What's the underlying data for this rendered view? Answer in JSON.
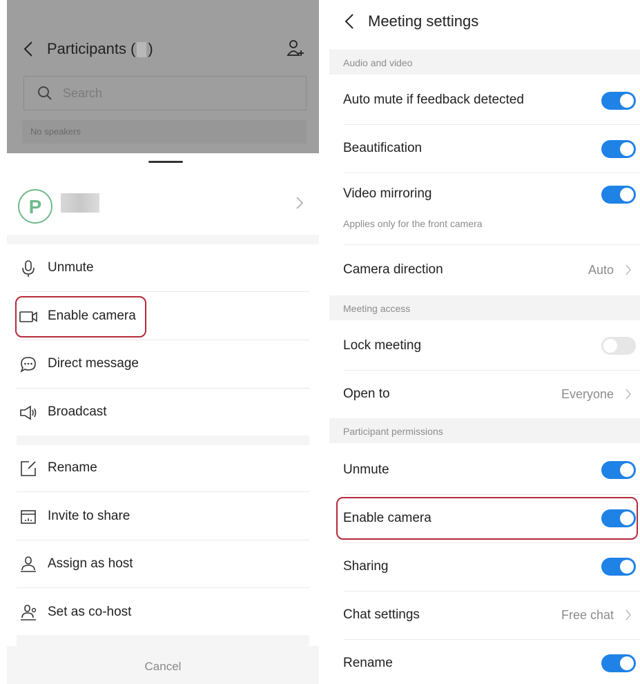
{
  "participants_panel": {
    "title": "Participants (",
    "title_suffix": ")",
    "search_placeholder": "Search",
    "no_speakers": "No speakers",
    "avatar_letter": "P",
    "menu": [
      {
        "label": "Unmute",
        "icon": "microphone-icon"
      },
      {
        "label": "Enable camera",
        "icon": "camera-icon"
      },
      {
        "label": "Direct message",
        "icon": "chat-icon"
      },
      {
        "label": "Broadcast",
        "icon": "megaphone-icon"
      },
      {
        "label": "Rename",
        "icon": "edit-icon"
      },
      {
        "label": "Invite to share",
        "icon": "share-screen-icon"
      },
      {
        "label": "Assign as host",
        "icon": "host-icon"
      },
      {
        "label": "Set as co-host",
        "icon": "co-host-icon"
      }
    ],
    "cancel_label": "Cancel"
  },
  "settings_panel": {
    "title": "Meeting settings",
    "sections": {
      "audio_video": "Audio and video",
      "meeting_access": "Meeting access",
      "participant_permissions": "Participant permissions"
    },
    "rows": {
      "auto_mute": {
        "label": "Auto mute if feedback detected",
        "on": true
      },
      "beautification": {
        "label": "Beautification",
        "on": true
      },
      "video_mirroring": {
        "label": "Video mirroring",
        "on": true,
        "note": "Applies only for the front camera"
      },
      "camera_direction": {
        "label": "Camera direction",
        "value": "Auto"
      },
      "lock_meeting": {
        "label": "Lock meeting",
        "on": false
      },
      "open_to": {
        "label": "Open to",
        "value": "Everyone"
      },
      "unmute": {
        "label": "Unmute",
        "on": true
      },
      "enable_camera": {
        "label": "Enable camera",
        "on": true
      },
      "sharing": {
        "label": "Sharing",
        "on": true
      },
      "chat_settings": {
        "label": "Chat settings",
        "value": "Free chat"
      },
      "rename": {
        "label": "Rename",
        "on": true
      }
    }
  },
  "colors": {
    "toggle_on": "#1f82e6",
    "highlight": "#b52a3a",
    "avatar": "#6fb98a"
  }
}
